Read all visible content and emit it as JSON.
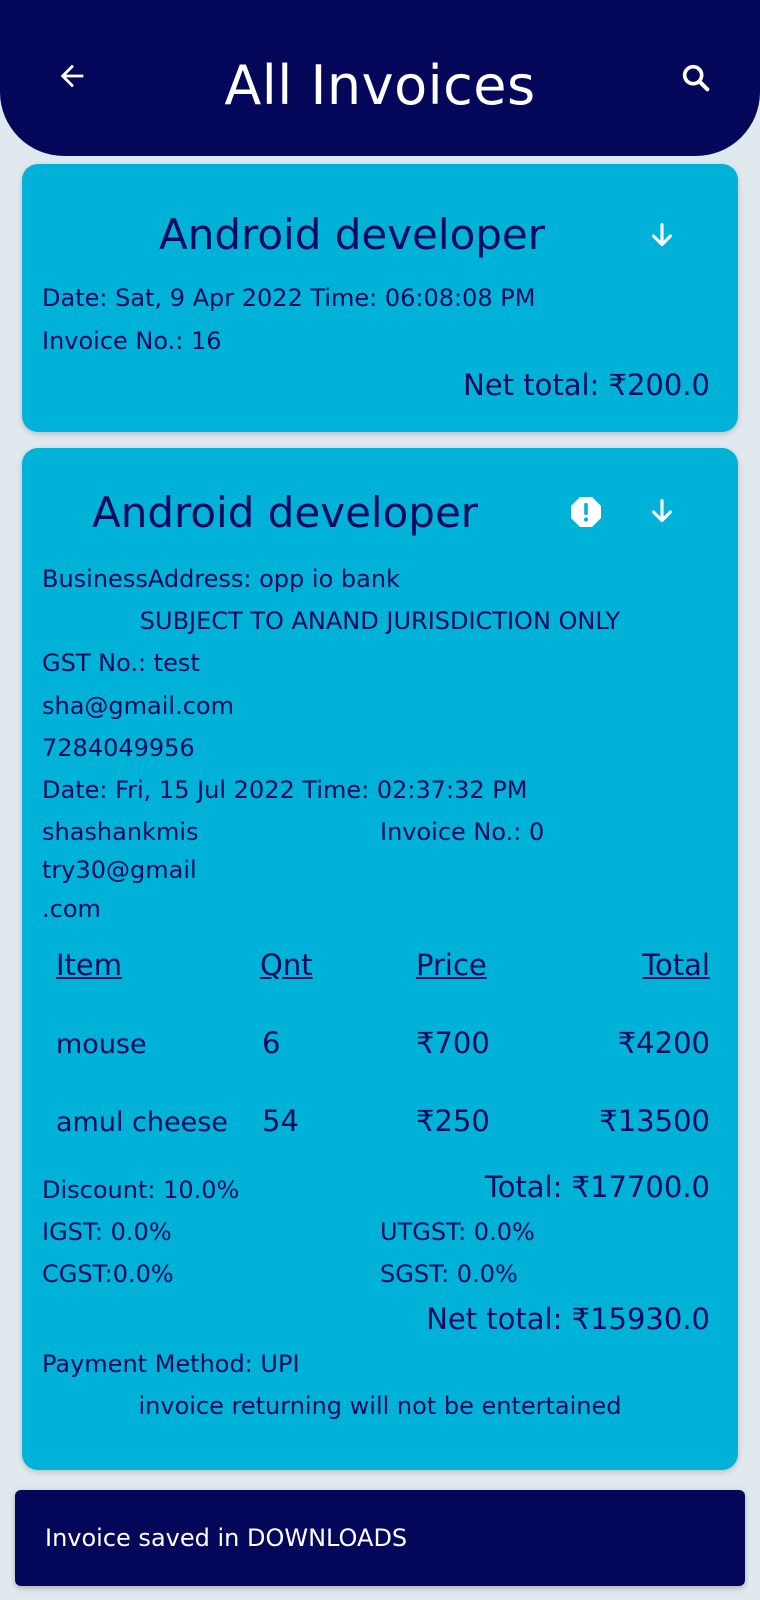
{
  "appbar": {
    "title": "All Invoices",
    "back_icon": "arrow-left-icon",
    "search_icon": "search-icon"
  },
  "colors": {
    "appbar_bg": "#05075b",
    "card_bg": "#00b2d8",
    "text": "#08095f",
    "page_bg": "#dfe9ee"
  },
  "invoices": [
    {
      "title": "Android developer",
      "date_line": "Date:  Sat, 9 Apr 2022 Time:  06:08:08 PM",
      "invoice_no": "Invoice No.: 16",
      "net_total": "Net total: ₹200.0",
      "download_icon": "arrow-down-icon"
    },
    {
      "title": "Android developer",
      "business_address": "BusinessAddress: opp io bank",
      "jurisdiction": "SUBJECT TO ANAND JURISDICTION ONLY",
      "gst": "GST No.: test",
      "email": "sha@gmail.com",
      "phone": "7284049956",
      "date_line": "Date:  Fri, 15 Jul 2022 Time:  02:37:32 PM",
      "customer_email_1": "shashankmis",
      "customer_email_2": "try30@gmail",
      "customer_email_3": ".com",
      "invoice_no": "Invoice No.: 0",
      "headers": {
        "item": "Item",
        "qnt": "Qnt",
        "price": "Price",
        "total": "Total"
      },
      "rows": [
        {
          "item": "mouse",
          "qnt": "6",
          "price": "₹700",
          "total": "₹4200"
        },
        {
          "item": "amul cheese",
          "qnt": "54",
          "price": "₹250",
          "total": "₹13500"
        }
      ],
      "discount": "Discount: 10.0%",
      "total": "Total: ₹17700.0",
      "igst": "IGST: 0.0%",
      "utgst": "UTGST: 0.0%",
      "cgst": "CGST:0.0%",
      "sgst": "SGST: 0.0%",
      "net_total": "Net total: ₹15930.0",
      "payment_method": "Payment Method: UPI",
      "footer_note": "invoice returning will not be entertained",
      "alert_icon": "exclamation-circle-icon",
      "download_icon": "arrow-down-icon"
    }
  ],
  "snackbar": {
    "message": "Invoice saved in DOWNLOADS"
  }
}
